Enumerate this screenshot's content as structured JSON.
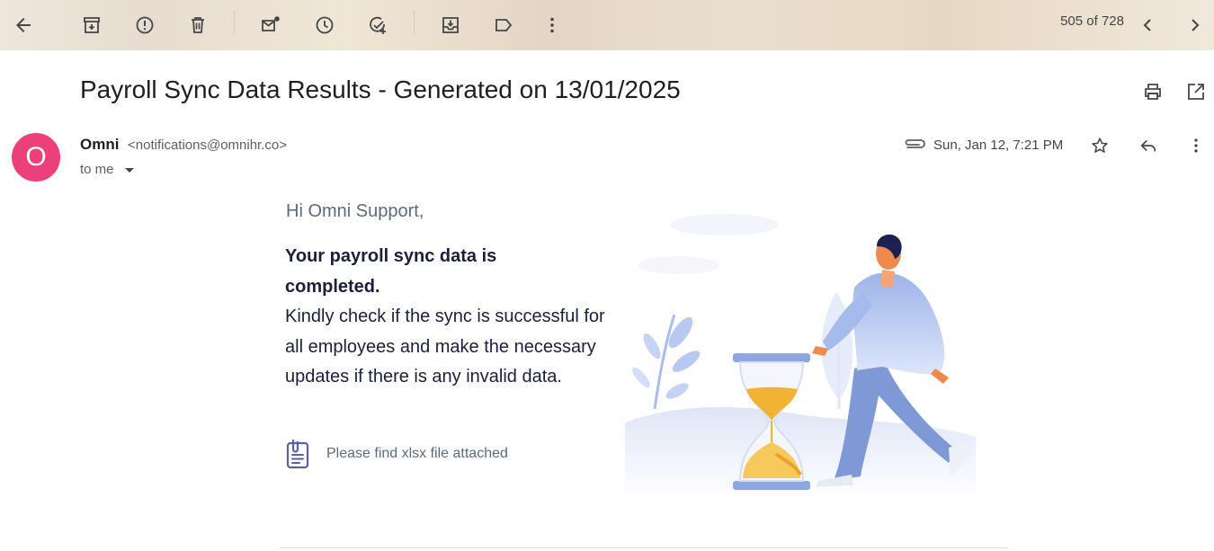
{
  "toolbar": {
    "pager": "505 of 728"
  },
  "email": {
    "subject": "Payroll Sync Data Results - Generated on 13/01/2025",
    "sender": {
      "avatar_letter": "O",
      "name": "Omni",
      "email": "<notifications@omnihr.co>",
      "recipient": "to me"
    },
    "date": "Sun, Jan 12, 7:21 PM",
    "body": {
      "greeting": "Hi Omni Support,",
      "headline_line1": "Your payroll sync data is",
      "headline_line2": "completed.",
      "paragraph": "Kindly check if the sync is successful for all employees and make the necessary updates if there is any invalid data.",
      "attachment_note": "Please find xlsx file attached"
    }
  },
  "colors": {
    "avatar": "#ec407a",
    "accent": "#8ea7e0",
    "hourglass_sand": "#f2b233"
  }
}
